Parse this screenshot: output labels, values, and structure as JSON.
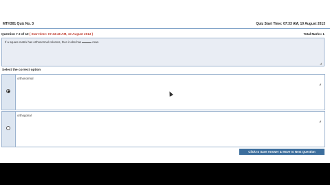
{
  "header": {
    "quiz_title": "MTH301 Quiz No. 3",
    "quiz_start_time": "Quiz Start Time: 07:33 AM, 10 August 2013"
  },
  "question": {
    "number_text": "Question # 2 of 10",
    "start_time_text": "( Start time: 07:33:46 AM, 10 August 2013 )",
    "total_marks_text": "Total Marks: 1",
    "text_before_blank": "If a square matrix has orthonormal columns, then it also has",
    "text_after_blank": "rows."
  },
  "select_label": "Select the correct option",
  "options": [
    {
      "label": "orthonormal",
      "selected": true
    },
    {
      "label": "orthogonal",
      "selected": false
    }
  ],
  "next_button_label": "Click to Save Answer & Move to Next Question"
}
